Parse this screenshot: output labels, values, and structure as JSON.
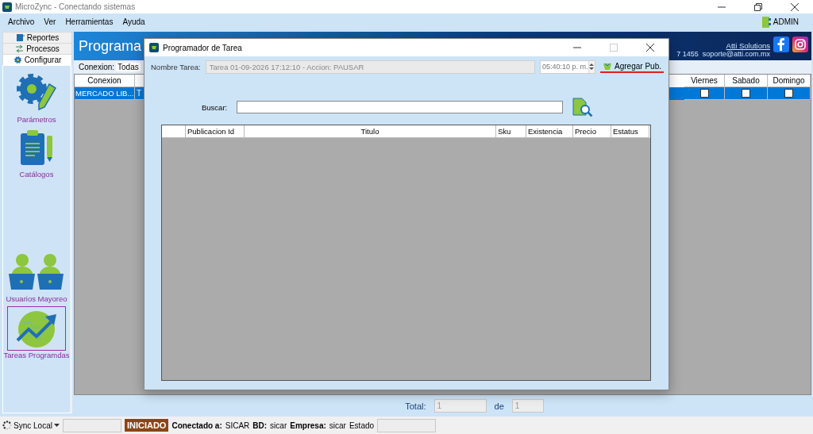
{
  "window": {
    "title": "MicroZync - Conectando sistemas"
  },
  "menu": [
    "Archivo",
    "Ver",
    "Herramientas",
    "Ayuda"
  ],
  "user": "ADMIN",
  "sidebar": {
    "tabs": [
      {
        "label": "Reportes",
        "kind": "book",
        "selected": false
      },
      {
        "label": "Procesos",
        "kind": "flow",
        "selected": false
      },
      {
        "label": "Configurar",
        "kind": "gear",
        "selected": true
      }
    ],
    "items": [
      {
        "label": "Parámetros",
        "kind": "gear",
        "selected": false
      },
      {
        "label": "Catálogos",
        "kind": "clipboard",
        "selected": false
      },
      {
        "label": "Usuarios Mayoreo",
        "kind": "users",
        "selected": false
      },
      {
        "label": "Tareas Programdas",
        "kind": "chart",
        "selected": true
      }
    ]
  },
  "header": {
    "title": "Programa",
    "link": "Atti Solutions",
    "contact": "7 1455  soporte@atti.com.mx"
  },
  "filter": {
    "label": "Conexion:",
    "value": "Todas"
  },
  "grid": {
    "columns": [
      "Conexion",
      "Viernes",
      "Sabado",
      "Domingo"
    ],
    "rows": [
      {
        "selected": true,
        "conexion": "MERCADO LIB...",
        "column_2": "T",
        "days": [
          {
            "checked": false
          },
          {
            "checked": false
          },
          {
            "checked": false
          }
        ]
      }
    ]
  },
  "footer": {
    "total_label": "Total:",
    "total": "1",
    "of_label": "de",
    "of": "1"
  },
  "status_bar": {
    "sync": "Sync Local",
    "badge": "INICIADO",
    "items": [
      {
        "label": "Conectado a:",
        "value": "SICAR"
      },
      {
        "label": "BD:",
        "value": "sicar"
      },
      {
        "label": "Empresa:",
        "value": "sicar"
      }
    ],
    "estado_label": "Estado"
  },
  "dialog": {
    "title": "Programador de Tarea",
    "name_label": "Nombre Tarea:",
    "name_value": "Tarea 01-09-2026 17:12:10 - Accion: PAUSAR",
    "time": "05:40:10 p. m.",
    "add_button": "Agregar Pub.",
    "search_label": "Buscar:",
    "columns": [
      "Publicacion Id",
      "Titulo",
      "Sku",
      "Existencia",
      "Precio",
      "Estatus"
    ]
  }
}
